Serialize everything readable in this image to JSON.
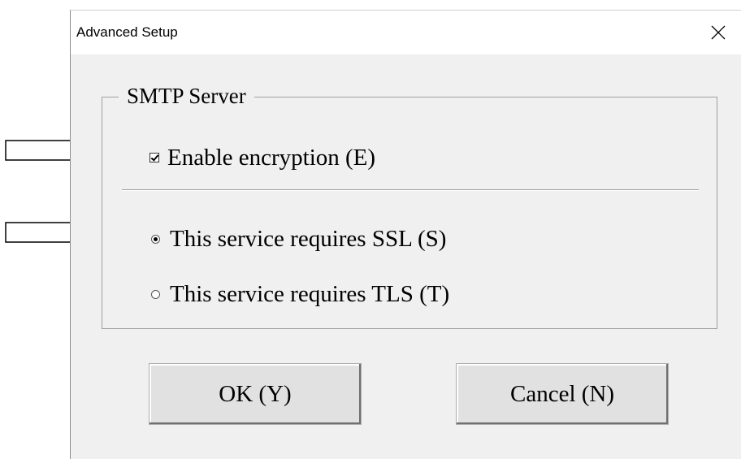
{
  "window": {
    "title": "Advanced Setup",
    "close_icon": "close-icon"
  },
  "group": {
    "label": "SMTP Server",
    "encryption": {
      "label": "Enable encryption (E)",
      "checked": true
    },
    "options": [
      {
        "label": "This service requires SSL (S)",
        "selected": true
      },
      {
        "label": "This service requires  TLS (T)",
        "selected": false
      }
    ]
  },
  "buttons": {
    "ok": "OK (Y)",
    "cancel": "Cancel (N)"
  },
  "annotations": {
    "arrow_icon": "right-arrow-icon"
  }
}
